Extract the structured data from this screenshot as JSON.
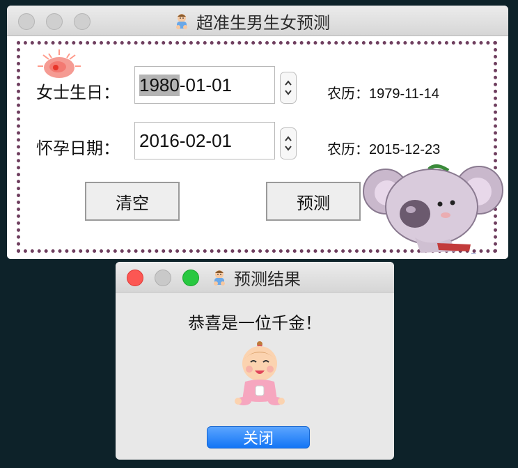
{
  "main_window": {
    "title": "超准生男生女预测",
    "title_icon": "baby-icon",
    "mother_birthday": {
      "label": "女士生日：",
      "value_selected": "1980",
      "value_rest": "-01-01",
      "lunar": "农历：1979-11-14"
    },
    "conception_date": {
      "label": "怀孕日期：",
      "value": "2016-02-01",
      "lunar": "农历：2015-12-23"
    },
    "buttons": {
      "clear": "清空",
      "predict": "预测"
    }
  },
  "dialog": {
    "title": "预测结果",
    "title_icon": "baby-icon",
    "message": "恭喜是一位千金！",
    "result_image": "baby-girl-icon",
    "close_label": "关闭"
  },
  "colors": {
    "close_red": "#fc5753",
    "maximize_green": "#28c840",
    "button_blue": "#1375f5",
    "frame_border": "#6f3f5f",
    "desktop": "#0d2229"
  }
}
